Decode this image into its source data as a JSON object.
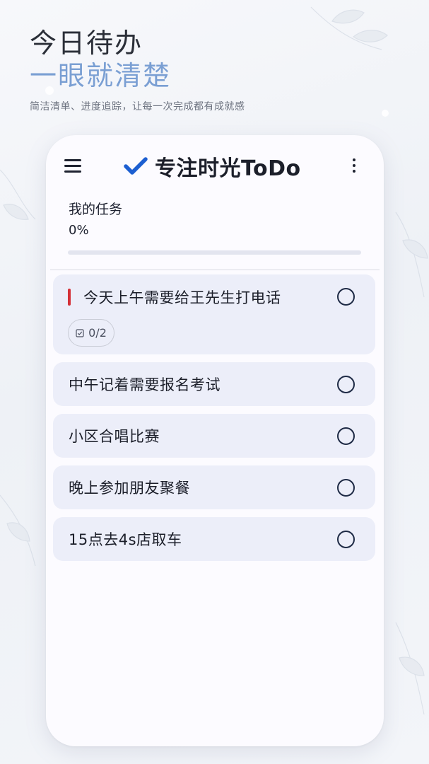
{
  "promo": {
    "line1": "今日待办",
    "line2": "一眼就清楚",
    "subtitle": "简洁清单、进度追踪，让每一次完成都有成就感"
  },
  "appbar": {
    "title": "专注时光ToDo",
    "menu_icon": "menu-icon",
    "check_icon": "checkmark-icon",
    "more_icon": "more-vert-icon"
  },
  "list": {
    "title": "我的任务",
    "progress_text": "0%",
    "progress_value": 0
  },
  "tasks": [
    {
      "label": "今天上午需要给王先生打电话",
      "priority": "high",
      "subtasks": "0/2",
      "done": false
    },
    {
      "label": "中午记着需要报名考试",
      "done": false
    },
    {
      "label": "小区合唱比赛",
      "done": false
    },
    {
      "label": "晚上参加朋友聚餐",
      "done": false
    },
    {
      "label": "15点去4s店取车",
      "done": false
    }
  ],
  "colors": {
    "accent": "#1d5fd1",
    "priority_high": "#d42f36",
    "headline_blue": "#7a9fd3",
    "card_bg": "#eceef9"
  }
}
